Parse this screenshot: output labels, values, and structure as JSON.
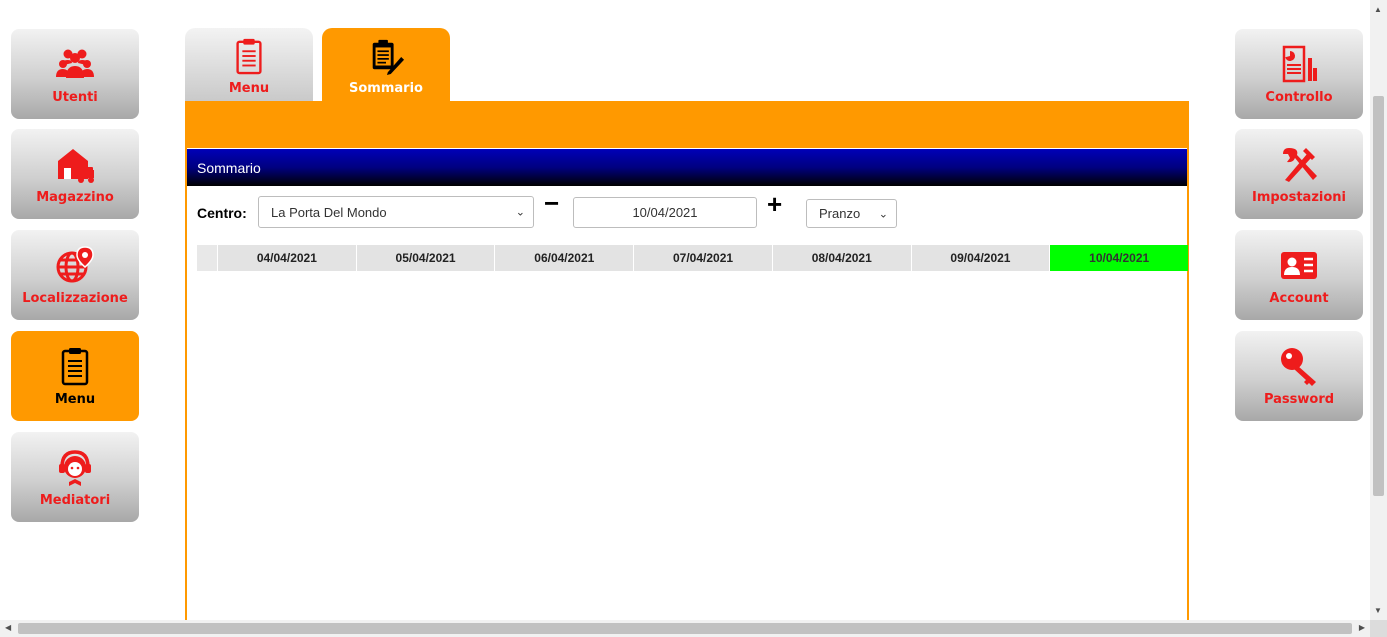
{
  "left_nav": [
    {
      "id": "utenti",
      "label": "Utenti",
      "icon": "users-icon"
    },
    {
      "id": "magazzino",
      "label": "Magazzino",
      "icon": "warehouse-truck-icon"
    },
    {
      "id": "localizzazione",
      "label": "Localizzazione",
      "icon": "globe-pin-icon"
    },
    {
      "id": "menu",
      "label": "Menu",
      "icon": "clipboard-icon",
      "active": true
    },
    {
      "id": "mediatori",
      "label": "Mediatori",
      "icon": "headset-person-icon"
    }
  ],
  "right_nav": [
    {
      "id": "controllo",
      "label": "Controllo",
      "icon": "report-chart-icon"
    },
    {
      "id": "impostazioni",
      "label": "Impostazioni",
      "icon": "tools-icon"
    },
    {
      "id": "account",
      "label": "Account",
      "icon": "id-card-icon"
    },
    {
      "id": "password",
      "label": "Password",
      "icon": "key-icon"
    }
  ],
  "tabs": [
    {
      "id": "menu",
      "label": "Menu",
      "icon": "clipboard-icon"
    },
    {
      "id": "sommario",
      "label": "Sommario",
      "icon": "clipboard-pencil-icon",
      "active": true
    }
  ],
  "panel": {
    "title": "Sommario",
    "centro_label": "Centro:",
    "centro_value": "La Porta Del Mondo",
    "minus_label": "−",
    "plus_label": "+",
    "date_value": "10/04/2021",
    "pasto_value": "Pranzo"
  },
  "dates": [
    "04/04/2021",
    "05/04/2021",
    "06/04/2021",
    "07/04/2021",
    "08/04/2021",
    "09/04/2021",
    "10/04/2021"
  ],
  "selected_date": "10/04/2021",
  "colors": {
    "accent": "#ff9900",
    "label_red": "#ee1c1c",
    "title_bar": "#000080",
    "selected_date_bg": "#00ff00"
  }
}
